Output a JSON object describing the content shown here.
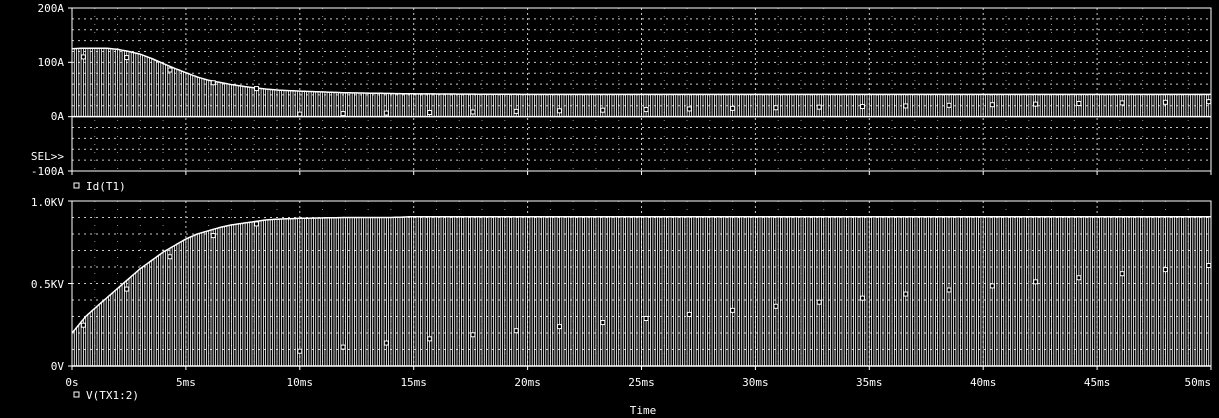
{
  "colors": {
    "background": "#000000",
    "foreground": "#ffffff",
    "grid": "#c8c8c8"
  },
  "chart_data": [
    {
      "type": "area",
      "plot": "top",
      "series": [
        {
          "name": "Id(T1)",
          "marker": "small-square",
          "x": [
            0,
            0.5,
            1,
            1.5,
            2,
            2.5,
            3,
            3.5,
            4,
            4.5,
            5,
            5.5,
            6,
            7,
            8,
            9,
            10,
            12,
            15,
            20,
            25,
            30,
            35,
            40,
            45,
            50
          ],
          "envelope": [
            125,
            126,
            126,
            126,
            124,
            120,
            115,
            107,
            98,
            89,
            81,
            73,
            67,
            59,
            53,
            49,
            47,
            44,
            42,
            41,
            41,
            41,
            41,
            41,
            41,
            41
          ],
          "switching_period_ms": 0.2
        }
      ],
      "ylabels": [
        "200A",
        "100A",
        "0A",
        "-100A"
      ],
      "ylim": [
        -100,
        200
      ],
      "xlim": [
        0,
        50
      ],
      "grid": true,
      "annotation": "SEL>>",
      "legend": "bottom-left"
    },
    {
      "type": "area",
      "plot": "bottom",
      "series": [
        {
          "name": "V(TX1:2)",
          "marker": "small-square",
          "x": [
            0,
            0.3,
            0.6,
            1,
            1.5,
            2,
            2.5,
            3,
            3.5,
            4,
            4.5,
            5,
            5.5,
            6,
            6.5,
            7,
            7.5,
            8,
            8.5,
            9,
            10,
            12,
            14,
            15,
            20,
            25,
            30,
            35,
            40,
            45,
            50
          ],
          "envelope": [
            0.2,
            0.25,
            0.3,
            0.35,
            0.41,
            0.47,
            0.53,
            0.59,
            0.64,
            0.69,
            0.73,
            0.77,
            0.8,
            0.82,
            0.84,
            0.855,
            0.865,
            0.875,
            0.885,
            0.89,
            0.895,
            0.9,
            0.9,
            0.905,
            0.905,
            0.905,
            0.905,
            0.905,
            0.905,
            0.905,
            0.905
          ],
          "switching_period_ms": 0.2
        }
      ],
      "ylabels": [
        "1.0KV",
        "0.5KV",
        "0V"
      ],
      "ylim": [
        0,
        1.0
      ],
      "xlim": [
        0,
        50
      ],
      "grid": true,
      "legend": "bottom-left"
    }
  ],
  "xaxis": {
    "title": "Time",
    "ticks": [
      "0s",
      "5ms",
      "10ms",
      "15ms",
      "20ms",
      "25ms",
      "30ms",
      "35ms",
      "40ms",
      "45ms",
      "50ms"
    ]
  },
  "top": {
    "ticks": [
      "200A",
      "100A",
      "0A",
      "-100A"
    ],
    "annotation": "SEL>>",
    "legend": "Id(T1)"
  },
  "bottom": {
    "ticks": [
      "1.0KV",
      "0.5KV",
      "0V"
    ],
    "legend": "V(TX1:2)"
  }
}
